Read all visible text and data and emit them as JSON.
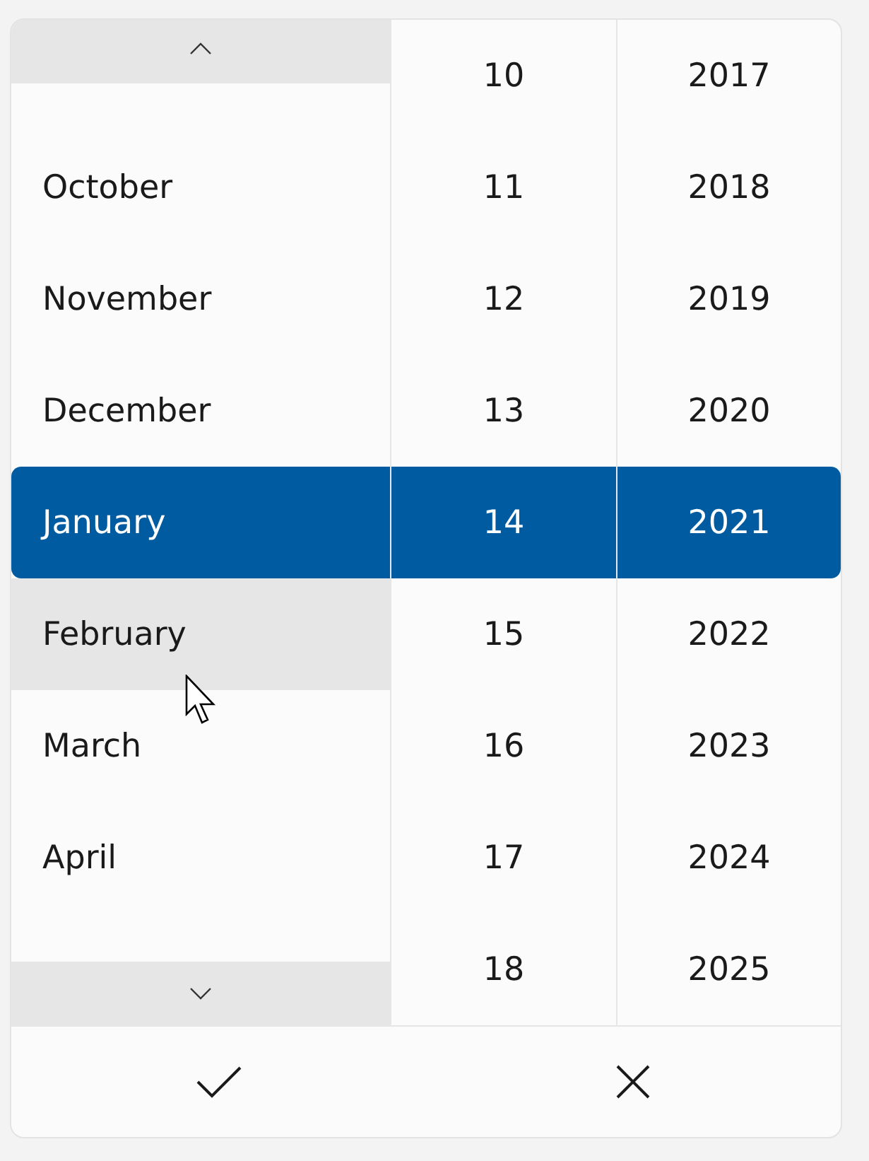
{
  "columns": [
    {
      "kind": "month",
      "scroll_buttons": true,
      "items": [
        {
          "label": "October",
          "selected": false,
          "hovered": false
        },
        {
          "label": "November",
          "selected": false,
          "hovered": false
        },
        {
          "label": "December",
          "selected": false,
          "hovered": false
        },
        {
          "label": "January",
          "selected": true,
          "hovered": false
        },
        {
          "label": "February",
          "selected": false,
          "hovered": true
        },
        {
          "label": "March",
          "selected": false,
          "hovered": false
        },
        {
          "label": "April",
          "selected": false,
          "hovered": false
        }
      ]
    },
    {
      "kind": "day",
      "items": [
        {
          "label": "10",
          "selected": false
        },
        {
          "label": "11",
          "selected": false
        },
        {
          "label": "12",
          "selected": false
        },
        {
          "label": "13",
          "selected": false
        },
        {
          "label": "14",
          "selected": true
        },
        {
          "label": "15",
          "selected": false
        },
        {
          "label": "16",
          "selected": false
        },
        {
          "label": "17",
          "selected": false
        },
        {
          "label": "18",
          "selected": false
        }
      ]
    },
    {
      "kind": "year",
      "items": [
        {
          "label": "2017",
          "selected": false
        },
        {
          "label": "2018",
          "selected": false
        },
        {
          "label": "2019",
          "selected": false
        },
        {
          "label": "2020",
          "selected": false
        },
        {
          "label": "2021",
          "selected": true
        },
        {
          "label": "2022",
          "selected": false
        },
        {
          "label": "2023",
          "selected": false
        },
        {
          "label": "2024",
          "selected": false
        },
        {
          "label": "2025",
          "selected": false
        }
      ]
    }
  ]
}
